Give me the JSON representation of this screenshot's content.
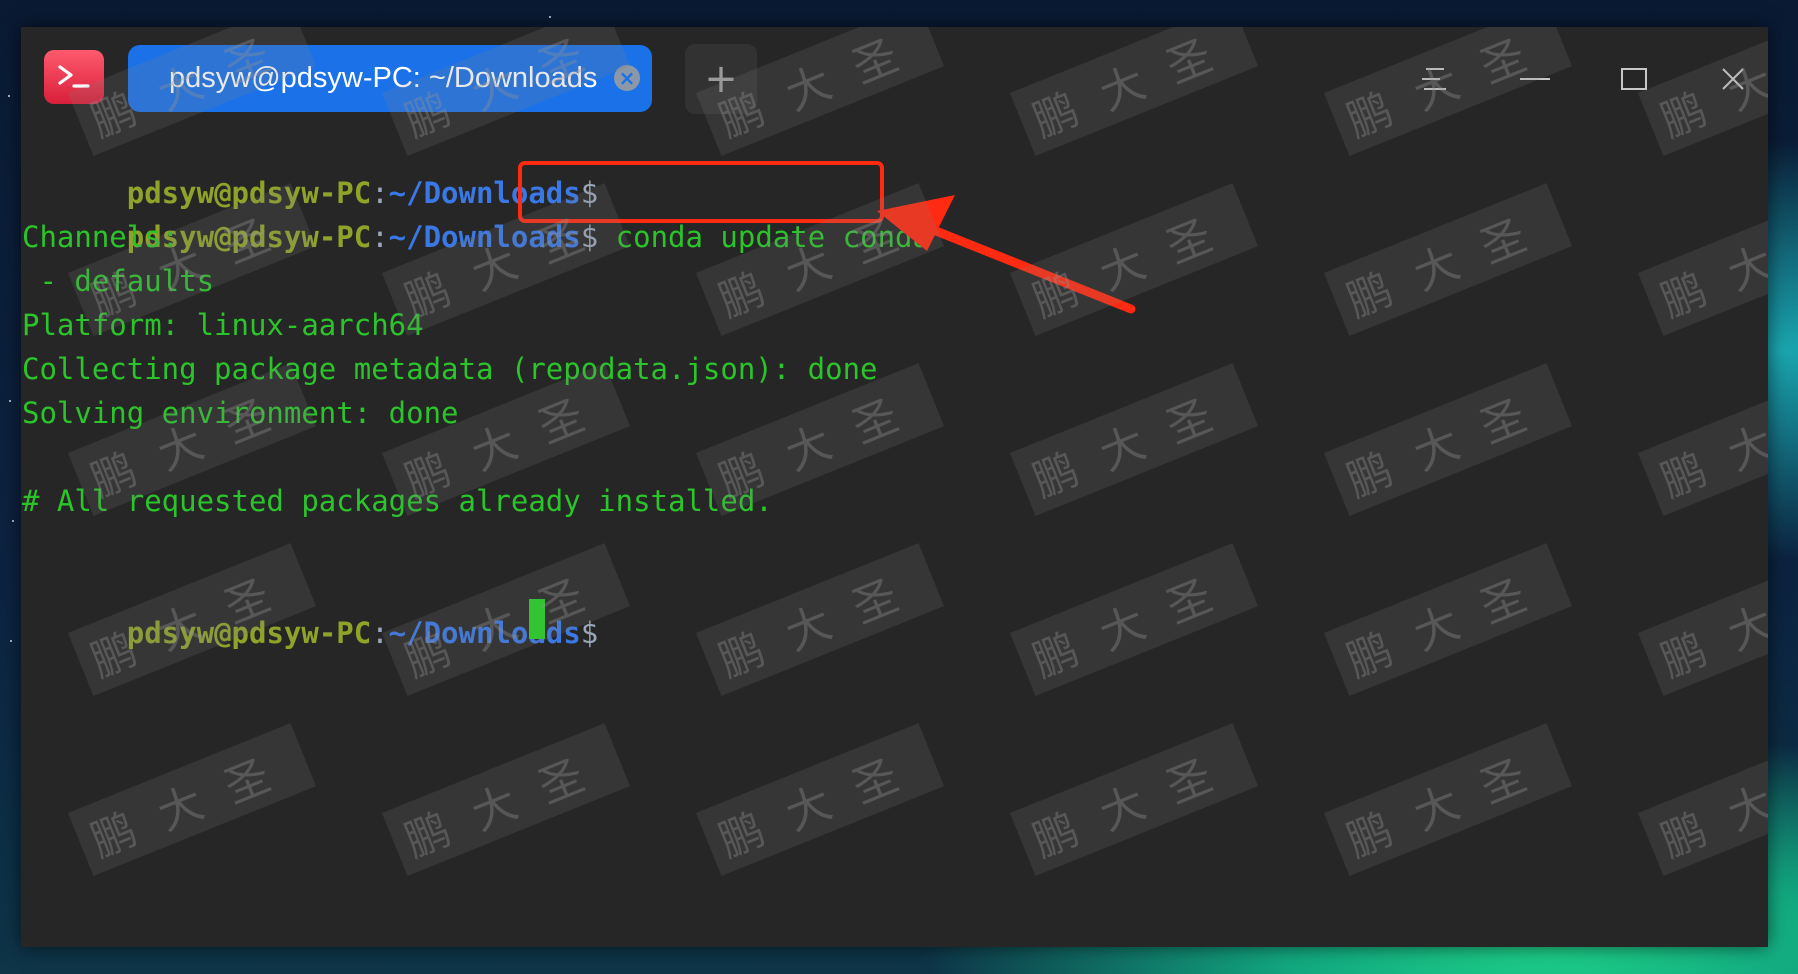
{
  "window": {
    "tab_title": "pdsyw@pdsyw-PC: ~/Downloads",
    "close_tab_glyph": "×",
    "new_tab_glyph": "+"
  },
  "icons": {
    "app": "terminal-app-icon",
    "menu": "hamburger-menu-icon",
    "minimize": "minimize-icon",
    "maximize": "maximize-icon",
    "close": "close-icon"
  },
  "terminal": {
    "prompt_user": "pdsyw@pdsyw-PC",
    "prompt_colon": ":",
    "prompt_path": "~/Downloads",
    "prompt_dollar": "$",
    "command": "conda update conda",
    "output": {
      "channels": "Channels:",
      "defaults": " - defaults",
      "platform": "Platform: linux-aarch64",
      "collecting": "Collecting package metadata (repodata.json): done",
      "solving": "Solving environment: done",
      "installed": "# All requested packages already installed."
    }
  },
  "watermark_text": "鹏大圣",
  "colors": {
    "terminal_bg": "#262626",
    "tab_active": "#1b72e8",
    "prompt_user": "#8fa32a",
    "prompt_path": "#3a78e6",
    "output_green": "#2bc42b",
    "annotation_red": "#ff2a12"
  }
}
